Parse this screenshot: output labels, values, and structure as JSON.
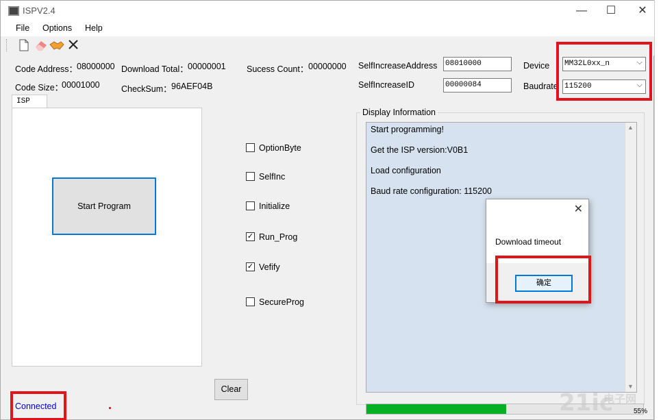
{
  "window": {
    "title": "ISPV2.4",
    "minimize_glyph": "—",
    "maximize_glyph": "☐",
    "close_glyph": "✕"
  },
  "menu": [
    "File",
    "Options",
    "Help"
  ],
  "toolbar_icons": [
    "new-file-icon",
    "eraser-icon",
    "handshake-icon",
    "close-icon"
  ],
  "info": {
    "code_address_label": "Code Address：",
    "code_address_value": "08000000",
    "download_total_label": "Download Total：",
    "download_total_value": "00000001",
    "success_count_label": "Sucess Count：",
    "success_count_value": "00000000",
    "code_size_label": "Code Size：",
    "code_size_value": "00001000",
    "checksum_label": "CheckSum：",
    "checksum_value": "96AEF04B",
    "self_increase_address_label": "SelfIncreaseAddress",
    "self_increase_address_value": "08010000",
    "self_increase_id_label": "SelfIncreaseID",
    "self_increase_id_value": "00000084",
    "device_label": "Device",
    "device_value": "MM32L0xx_n",
    "baudrate_label": "Baudrate",
    "baudrate_value": "115200"
  },
  "tab": {
    "label": "ISP"
  },
  "start_button": "Start Program",
  "options": [
    {
      "label": "OptionByte",
      "checked": false
    },
    {
      "label": "SelfInc",
      "checked": false
    },
    {
      "label": "Initialize",
      "checked": false
    },
    {
      "label": "Run_Prog",
      "checked": true
    },
    {
      "label": "Vefify",
      "checked": true
    },
    {
      "label": "SecureProg",
      "checked": false
    }
  ],
  "clear_button": "Clear",
  "display": {
    "group_label": "Display Information",
    "lines": [
      "Start programming!",
      "Get the ISP version:V0B1",
      "Load configuration",
      "Baud rate configuration: 115200"
    ]
  },
  "progress": {
    "percent": 0.505,
    "label": "55%"
  },
  "dialog": {
    "message": "Download timeout",
    "ok_label": "确定"
  },
  "status": {
    "text": "Connected"
  },
  "watermark": {
    "main": "21ic",
    "sub": "电子网"
  },
  "colors": {
    "highlight_red": "#e0151c",
    "progress_green": "#06b025",
    "display_bg": "#d6e2ef",
    "link_blue": "#0000cc"
  }
}
